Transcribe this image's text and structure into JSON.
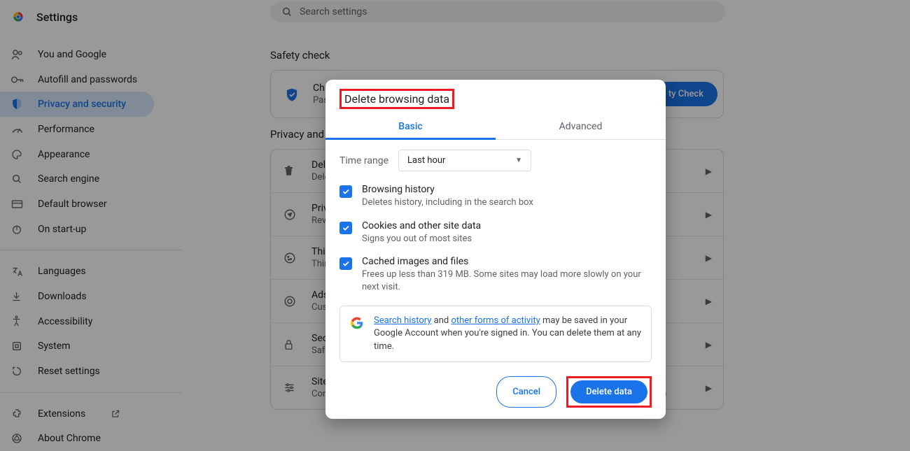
{
  "header": {
    "title": "Settings",
    "search_placeholder": "Search settings"
  },
  "sidebar": {
    "items": [
      {
        "label": "You and Google"
      },
      {
        "label": "Autofill and passwords"
      },
      {
        "label": "Privacy and security"
      },
      {
        "label": "Performance"
      },
      {
        "label": "Appearance"
      },
      {
        "label": "Search engine"
      },
      {
        "label": "Default browser"
      },
      {
        "label": "On start-up"
      }
    ],
    "bottom": [
      {
        "label": "Languages"
      },
      {
        "label": "Downloads"
      },
      {
        "label": "Accessibility"
      },
      {
        "label": "System"
      },
      {
        "label": "Reset settings"
      }
    ],
    "footer": [
      {
        "label": "Extensions"
      },
      {
        "label": "About Chrome"
      }
    ]
  },
  "main": {
    "safety_title": "Safety check",
    "safety_item_title": "Chro",
    "safety_item_sub": "Passw",
    "safety_btn": "ty Check",
    "ps_title": "Privacy and s",
    "rows": [
      {
        "t1": "Dele",
        "t2": "Dele"
      },
      {
        "t1": "Priva",
        "t2": "Revie"
      },
      {
        "t1": "Third",
        "t2": "Third"
      },
      {
        "t1": "Ads p",
        "t2": "Cust"
      },
      {
        "t1": "Secu",
        "t2": "Safe "
      },
      {
        "t1": "Site s",
        "t2": "Controls what information sites can use and show (location, camera, pop-ups and more)"
      }
    ]
  },
  "modal": {
    "title": "Delete browsing data",
    "tabs": {
      "basic": "Basic",
      "advanced": "Advanced"
    },
    "time_label": "Time range",
    "time_value": "Last hour",
    "items": [
      {
        "t1": "Browsing history",
        "t2": "Deletes history, including in the search box"
      },
      {
        "t1": "Cookies and other site data",
        "t2": "Signs you out of most sites"
      },
      {
        "t1": "Cached images and files",
        "t2": "Frees up less than 319 MB. Some sites may load more slowly on your next visit."
      }
    ],
    "info": {
      "link1": "Search history",
      "mid": " and ",
      "link2": "other forms of activity",
      "rest": " may be saved in your Google Account when you're signed in. You can delete them at any time."
    },
    "cancel": "Cancel",
    "delete": "Delete data"
  }
}
